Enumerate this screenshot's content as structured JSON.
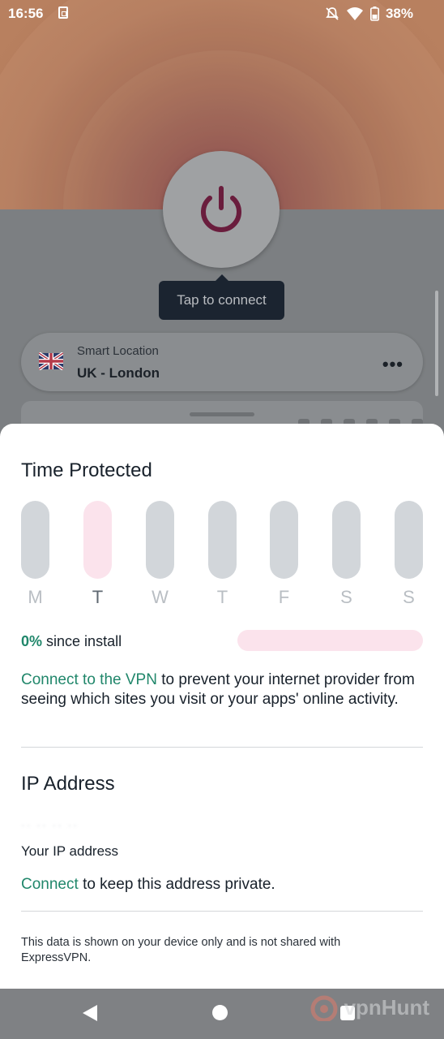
{
  "status_bar": {
    "time": "16:56",
    "battery": "38%",
    "icons": [
      "sim-icon",
      "mute-icon",
      "wifi-icon",
      "battery-icon"
    ]
  },
  "connect": {
    "power_icon": "power-icon",
    "tooltip": "Tap to connect",
    "accent_color": "#7a1f45"
  },
  "location": {
    "kicker": "Smart Location",
    "city": "UK - London",
    "flag": "uk-flag-icon",
    "menu_icon": "more-horizontal-icon"
  },
  "sheet": {
    "time_protected": {
      "title": "Time Protected",
      "days": [
        {
          "label": "M",
          "active": false
        },
        {
          "label": "T",
          "active": true
        },
        {
          "label": "W",
          "active": false
        },
        {
          "label": "T",
          "active": false
        },
        {
          "label": "F",
          "active": false
        },
        {
          "label": "S",
          "active": false
        },
        {
          "label": "S",
          "active": false
        }
      ],
      "since_pct": "0%",
      "since_text": "since install",
      "progress_fraction": 0,
      "cta_link": "Connect to the VPN",
      "cta_rest": "to prevent your internet provider from seeing which sites you visit or your apps' online activity."
    },
    "ip_address": {
      "title": "IP Address",
      "your_ip_label": "Your IP address",
      "cta_link": "Connect",
      "cta_rest": "to keep this address private."
    },
    "note": "This data is shown on your device only and is not shared with ExpressVPN."
  },
  "colors": {
    "link_green": "#21876b",
    "active_pink": "#fbe3ec",
    "inactive_gray": "#d2d6da"
  },
  "watermark": "vpnHunt"
}
